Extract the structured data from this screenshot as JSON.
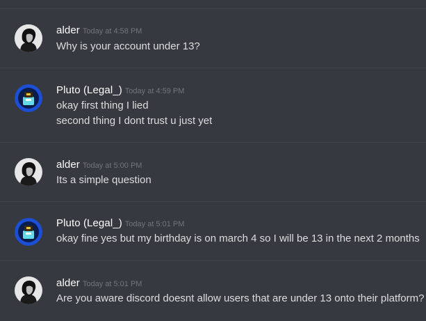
{
  "messages": [
    {
      "author": "alder",
      "timestamp": "Today at 4:58 PM",
      "avatar": "dark-portrait-avatar",
      "lines": [
        "Why is your account under 13?"
      ]
    },
    {
      "author": "Pluto (Legal_)",
      "timestamp": "Today at 4:59 PM",
      "avatar": "blue-badge-avatar",
      "lines": [
        "okay first thing I lied",
        "second thing I dont trust u just yet"
      ]
    },
    {
      "author": "alder",
      "timestamp": "Today at 5:00 PM",
      "avatar": "dark-portrait-avatar",
      "lines": [
        "Its a simple question"
      ]
    },
    {
      "author": "Pluto (Legal_)",
      "timestamp": "Today at 5:01 PM",
      "avatar": "blue-badge-avatar",
      "lines": [
        "okay fine yes but my birthday is on march 4 so I will be 13 in the next 2 months"
      ]
    },
    {
      "author": "alder",
      "timestamp": "Today at 5:01 PM",
      "avatar": "dark-portrait-avatar",
      "lines": [
        "Are you aware discord doesnt allow users that are under 13 onto their platform?"
      ]
    }
  ],
  "colors": {
    "background": "#36393f",
    "divider": "#42454a",
    "username": "#ffffff",
    "timestamp": "#72767d",
    "message_text": "#dcddde",
    "pluto_avatar_ring": "#1d4fd6"
  }
}
